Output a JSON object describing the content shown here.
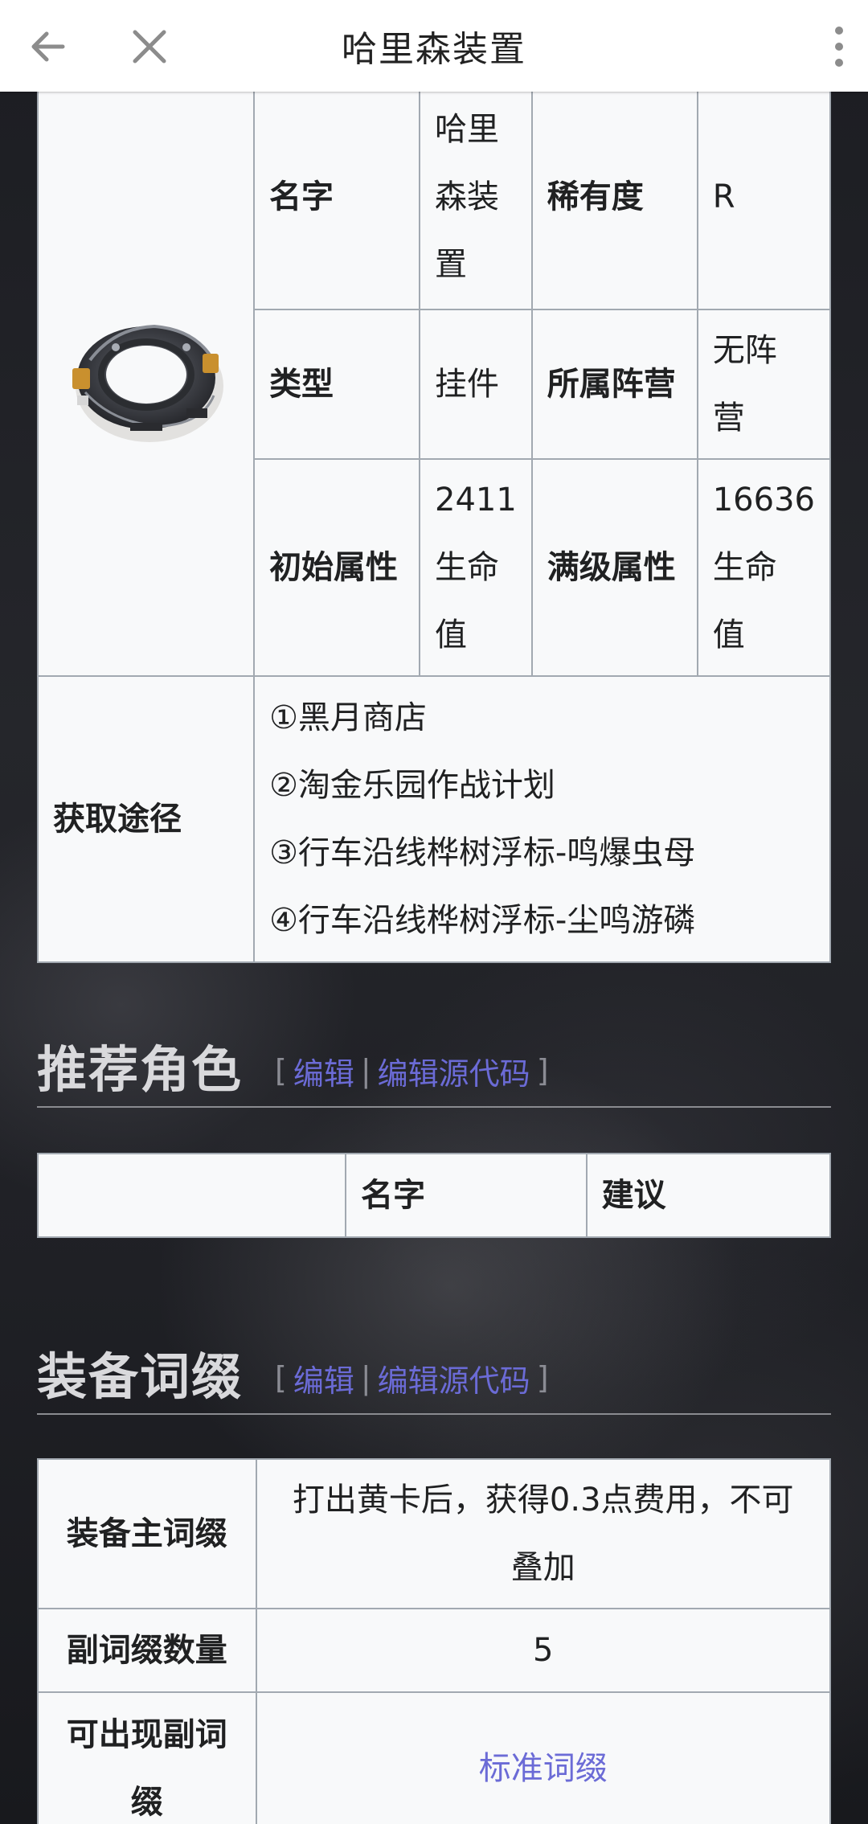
{
  "header": {
    "title": "哈里森装置"
  },
  "info": {
    "row1": {
      "label1": "名字",
      "value1": [
        "哈里",
        "森装",
        "置"
      ],
      "label2": "稀有度",
      "value2": "R"
    },
    "row2": {
      "label1": "类型",
      "value1": "挂件",
      "label2": "所属阵营",
      "value2": [
        "无阵",
        "营"
      ]
    },
    "row3": {
      "label1": "初始属性",
      "value1": [
        "2411",
        "生命",
        "值"
      ],
      "label2": "满级属性",
      "value2": [
        "16636",
        "生命",
        "值"
      ]
    },
    "acquire": {
      "label": "获取途径",
      "items": [
        "①黑月商店",
        "②淘金乐园作战计划",
        "③行车沿线桦树浮标-鸣爆虫母",
        "④行车沿线桦树浮标-尘鸣游磷"
      ]
    }
  },
  "sections": {
    "recommend": {
      "title": "推荐角色",
      "edit": "编辑",
      "edit_source": "编辑源代码",
      "open_bracket": "[",
      "close_bracket": "]",
      "sep": "|"
    },
    "affix": {
      "title": "装备词缀",
      "edit": "编辑",
      "edit_source": "编辑源代码",
      "open_bracket": "[",
      "close_bracket": "]",
      "sep": "|"
    }
  },
  "recommend_table": {
    "col_name": "名字",
    "col_suggest": "建议"
  },
  "affix_table": {
    "main_label": "装备主词缀",
    "main_value": [
      "打出黄卡后，获得0.3点费用，不可",
      "叠加"
    ],
    "count_label": "副词缀数量",
    "count_value": "5",
    "possible_label": [
      "可出现副词",
      "缀"
    ],
    "possible_value": "标准词缀"
  },
  "colors": {
    "link": "#6b6bd6",
    "table_bg": "#f8f9fa",
    "border": "#a2a9b1",
    "heading": "#d9d9dc"
  },
  "icons": {
    "back": "arrow-left-icon",
    "close": "close-icon",
    "more": "more-vertical-icon",
    "item": "ring-device-image"
  }
}
